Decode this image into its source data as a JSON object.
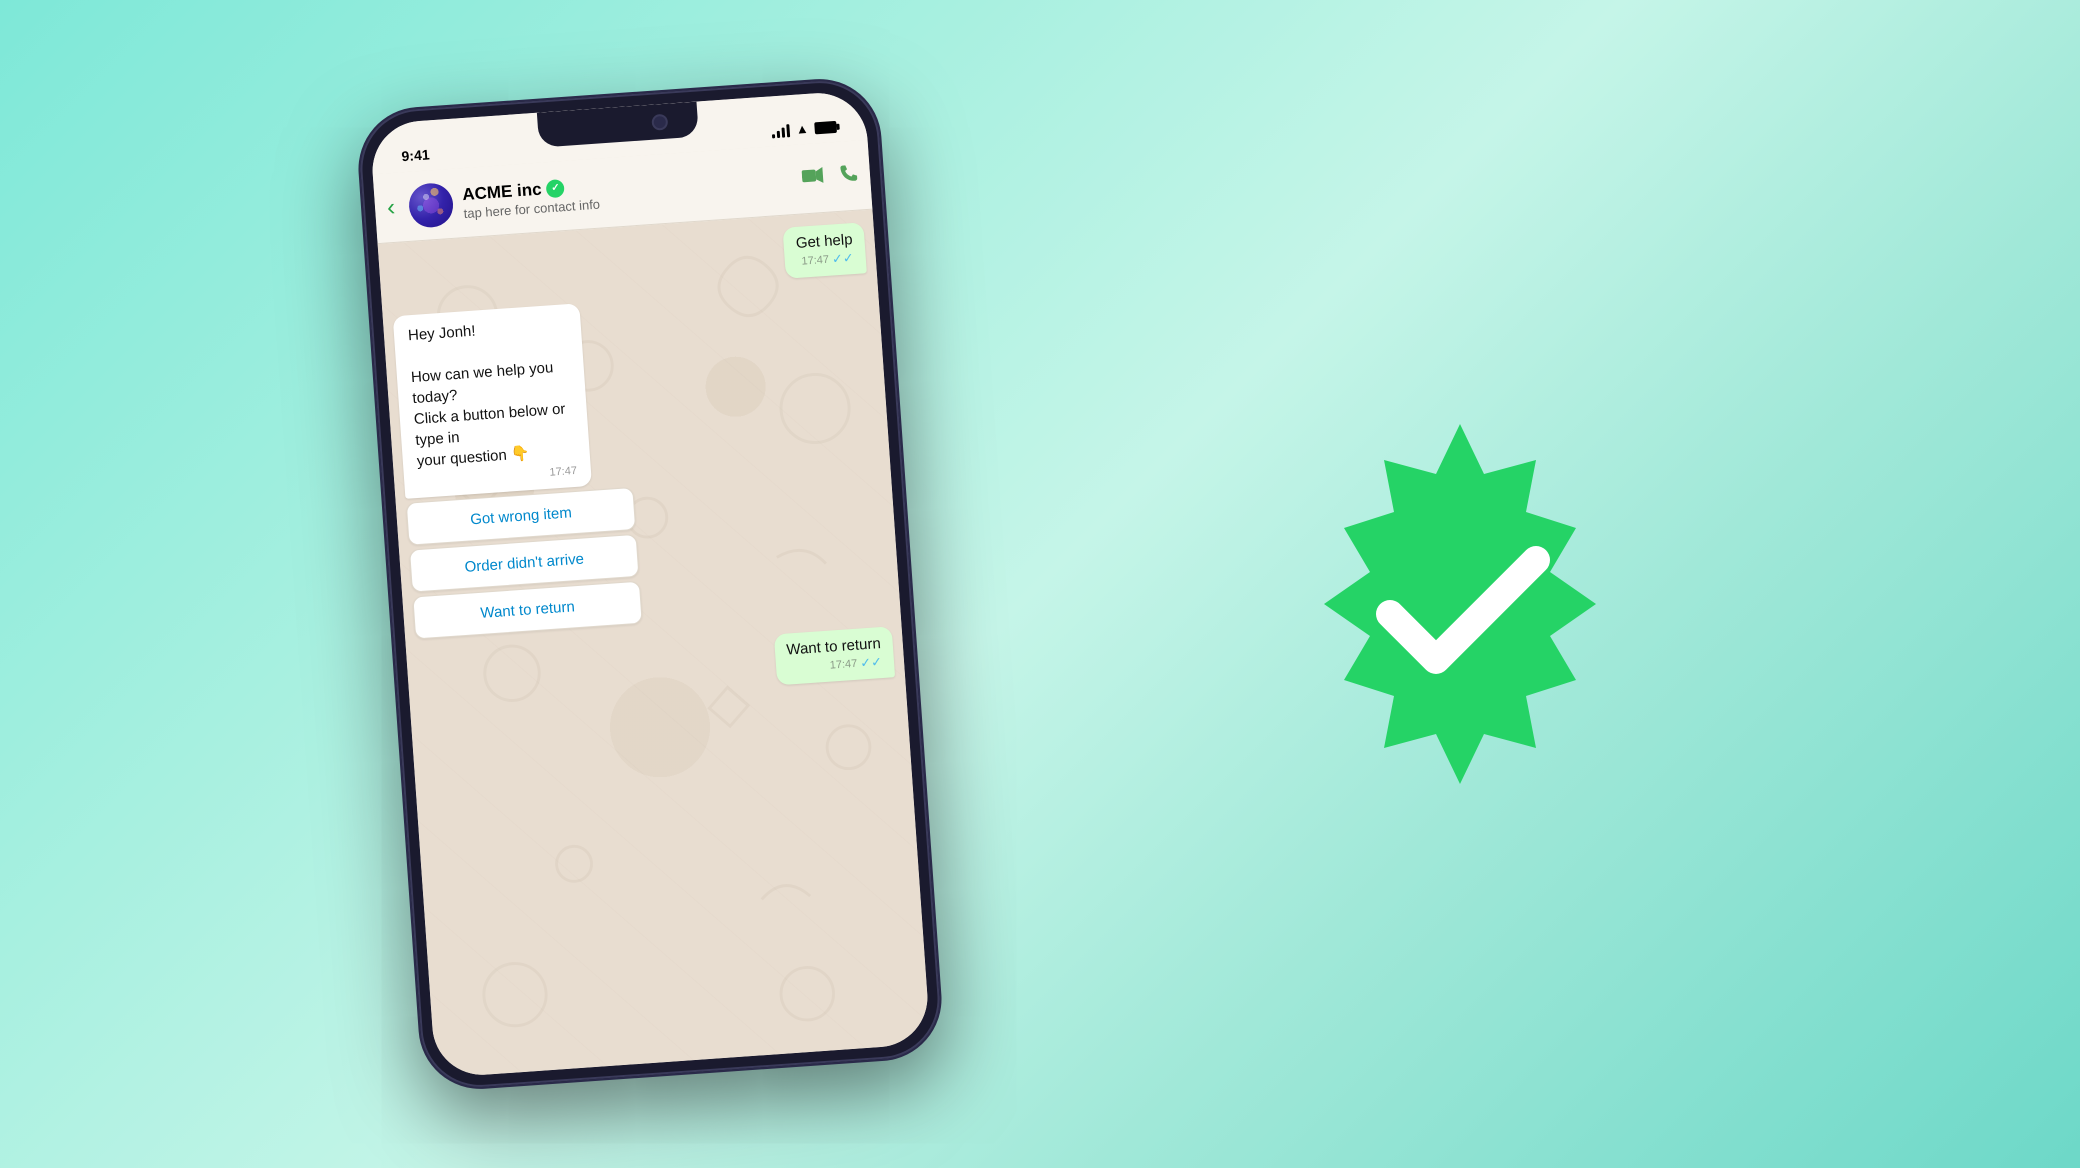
{
  "background": {
    "gradient_from": "#7ee8d8",
    "gradient_to": "#6dd8c8"
  },
  "phone": {
    "status_bar": {
      "time": "9:41",
      "signal": "●●●",
      "wifi": "wifi",
      "battery": "battery"
    },
    "header": {
      "contact_name": "ACME inc",
      "contact_verified": true,
      "contact_subtitle": "tap here for contact info",
      "back_label": "‹",
      "video_icon": "📹",
      "phone_icon": "📞"
    },
    "messages": [
      {
        "type": "outgoing",
        "text": "Get help",
        "time": "17:47",
        "ticks": "✓✓"
      },
      {
        "type": "incoming",
        "text": "Hey Jonh!\n\nHow can we help you today?\nClick a button below or type in\nyour question 👇",
        "time": "17:47",
        "quick_replies": [
          "Got wrong item",
          "Order didn't arrive",
          "Want to return"
        ]
      },
      {
        "type": "outgoing",
        "text": "Want to return",
        "time": "17:47",
        "ticks": "✓✓"
      }
    ]
  },
  "badge": {
    "color": "#25d366",
    "checkmark_color": "#ffffff"
  }
}
